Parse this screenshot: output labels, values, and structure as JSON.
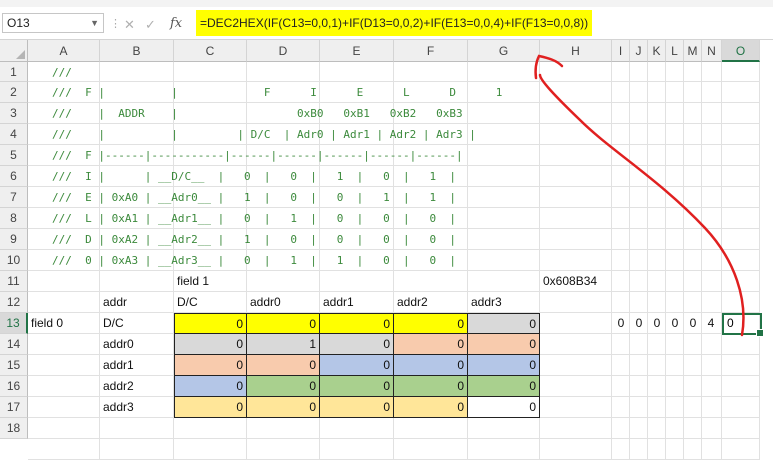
{
  "namebox": "O13",
  "formula": "=DEC2HEX(IF(C13=0,0,1)+IF(D13=0,0,2)+IF(E13=0,0,4)+IF(F13=0,0,8))",
  "columns": [
    "A",
    "B",
    "C",
    "D",
    "E",
    "F",
    "G",
    "H",
    "I",
    "J",
    "K",
    "L",
    "M",
    "N",
    "O"
  ],
  "rows": [
    "1",
    "2",
    "3",
    "4",
    "5",
    "6",
    "7",
    "8",
    "9",
    "10",
    "11",
    "12",
    "13",
    "14",
    "15",
    "16",
    "17",
    "18"
  ],
  "comment_lines": [
    "///",
    "///  F |          |             F      I      E      L      D      1",
    "///    |  ADDR    |                  0xB0   0xB1   0xB2   0xB3",
    "///    |          |         | D/C  | Adr0 | Adr1 | Adr2 | Adr3 |",
    "///  F |------|-----------|------|------|------|------|------|",
    "///  I |      | __D/C__  |   0  |   0  |   1  |   0  |   1  |",
    "///  E | 0xA0 | __Adr0__ |   1  |   0  |   0  |   1  |   1  |",
    "///  L | 0xA1 | __Adr1__ |   0  |   1  |   0  |   0  |   0  |",
    "///  D | 0xA2 | __Adr2__ |   1  |   0  |   0  |   0  |   0  |",
    "///  0 | 0xA3 | __Adr3__ |   0  |   1  |   1  |   0  |   0  |"
  ],
  "labels": {
    "field1": "field 1",
    "hex": "0x608B34",
    "field0": "field 0",
    "header_row": [
      "addr",
      "D/C",
      "addr0",
      "addr1",
      "addr2",
      "addr3"
    ],
    "row_labels": [
      "D/C",
      "addr0",
      "addr1",
      "addr2",
      "addr3"
    ]
  },
  "matrix": [
    [
      "0",
      "0",
      "0",
      "0",
      "0"
    ],
    [
      "0",
      "1",
      "0",
      "0",
      "0"
    ],
    [
      "0",
      "0",
      "0",
      "0",
      "0"
    ],
    [
      "0",
      "0",
      "0",
      "0",
      "0"
    ],
    [
      "0",
      "0",
      "0",
      "0",
      "0"
    ]
  ],
  "matrix_colors": [
    [
      "#ffff00",
      "#ffff00",
      "#ffff00",
      "#ffff00",
      "#d9d9d9"
    ],
    [
      "#d9d9d9",
      "#d9d9d9",
      "#d9d9d9",
      "#f8cbad",
      "#f8cbad"
    ],
    [
      "#f8cbad",
      "#f8cbad",
      "#b4c6e7",
      "#b4c6e7",
      "#b4c6e7"
    ],
    [
      "#b4c6e7",
      "#a9d08e",
      "#a9d08e",
      "#a9d08e",
      "#a9d08e"
    ],
    [
      "#ffe699",
      "#ffe699",
      "#ffe699",
      "#ffe699",
      "#ffffff"
    ]
  ],
  "digits_row13": [
    "0",
    "0",
    "0",
    "0",
    "0",
    "4"
  ],
  "active_cell_value": "0"
}
